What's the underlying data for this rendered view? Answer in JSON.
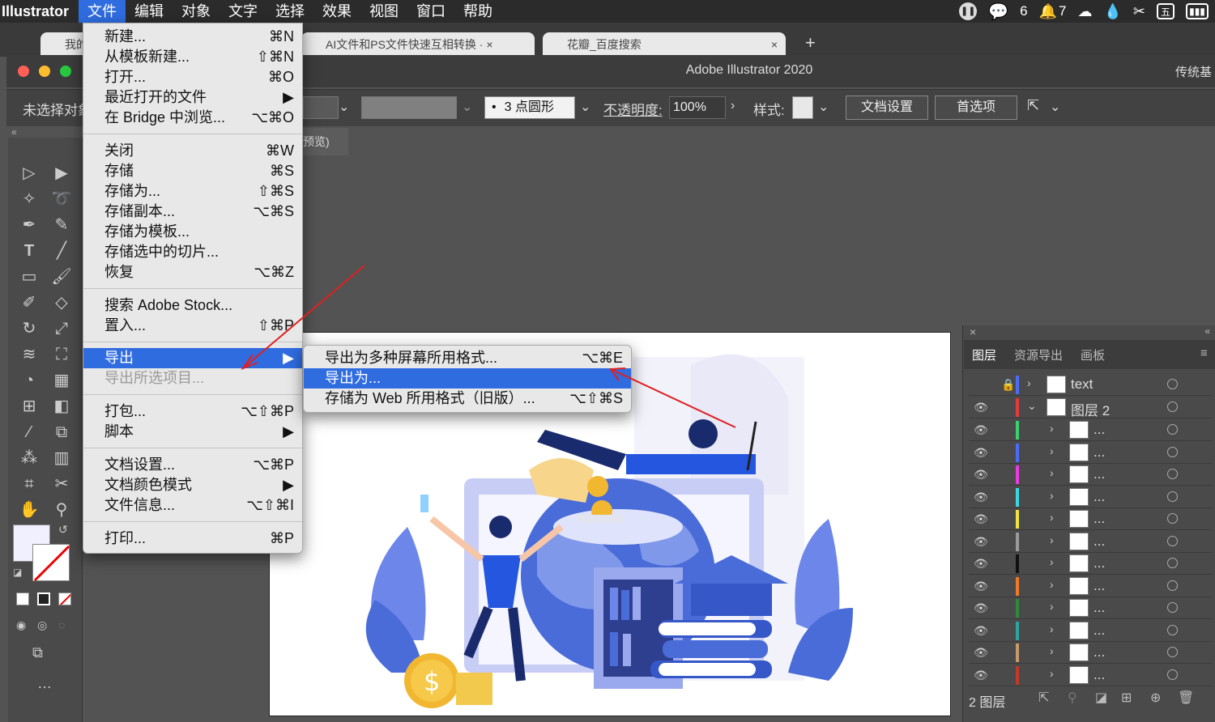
{
  "menubar": {
    "app_name": "Illustrator",
    "items": [
      "文件",
      "编辑",
      "对象",
      "文字",
      "选择",
      "效果",
      "视图",
      "窗口",
      "帮助"
    ],
    "right": {
      "wechat_count": "6",
      "bell_count": "7",
      "input_method": "五"
    }
  },
  "browser": {
    "tab1": "我的",
    "tab2": "AI文件和PS文件快速互相转换 · ×",
    "tab3": "花瓣_百度搜索",
    "tab3_close": "×",
    "new_tab": "+"
  },
  "window": {
    "title": "Adobe Illustrator 2020",
    "workspace": "传统基",
    "left_label": "未选择对象"
  },
  "controlbar": {
    "stroke_profile": "3 点圆形",
    "opacity_label": "不透明度:",
    "opacity_value": "100%",
    "style_label": "样式:",
    "doc_setup_button": "文档设置",
    "prefs_button": "首选项"
  },
  "doc_tab_fragment": "预览)",
  "file_menu": {
    "items": [
      {
        "label": "新建...",
        "shortcut": "⌘N"
      },
      {
        "label": "从模板新建...",
        "shortcut": "⇧⌘N"
      },
      {
        "label": "打开...",
        "shortcut": "⌘O"
      },
      {
        "label": "最近打开的文件",
        "shortcut": "▶"
      },
      {
        "label": "在 Bridge 中浏览...",
        "shortcut": "⌥⌘O"
      },
      {
        "label": "关闭",
        "shortcut": "⌘W"
      },
      {
        "label": "存储",
        "shortcut": "⌘S"
      },
      {
        "label": "存储为...",
        "shortcut": "⇧⌘S"
      },
      {
        "label": "存储副本...",
        "shortcut": "⌥⌘S"
      },
      {
        "label": "存储为模板...",
        "shortcut": ""
      },
      {
        "label": "存储选中的切片...",
        "shortcut": ""
      },
      {
        "label": "恢复",
        "shortcut": "⌥⌘Z"
      },
      {
        "label": "搜索 Adobe Stock...",
        "shortcut": ""
      },
      {
        "label": "置入...",
        "shortcut": "⇧⌘P"
      },
      {
        "label": "导出",
        "shortcut": "▶"
      },
      {
        "label": "导出所选项目...",
        "shortcut": ""
      },
      {
        "label": "打包...",
        "shortcut": "⌥⇧⌘P"
      },
      {
        "label": "脚本",
        "shortcut": "▶"
      },
      {
        "label": "文档设置...",
        "shortcut": "⌥⌘P"
      },
      {
        "label": "文档颜色模式",
        "shortcut": "▶"
      },
      {
        "label": "文件信息...",
        "shortcut": "⌥⇧⌘I"
      },
      {
        "label": "打印...",
        "shortcut": "⌘P"
      }
    ]
  },
  "export_submenu": {
    "items": [
      {
        "label": "导出为多种屏幕所用格式...",
        "shortcut": "⌥⌘E"
      },
      {
        "label": "导出为...",
        "shortcut": ""
      },
      {
        "label": "存储为 Web 所用格式（旧版）...",
        "shortcut": "⌥⇧⌘S"
      }
    ]
  },
  "layers_panel": {
    "tabs": [
      "图层",
      "资源导出",
      "画板"
    ],
    "layers": [
      {
        "name": "text",
        "color": "#4a6cf7",
        "expanded": false,
        "locked": true
      },
      {
        "name": "图层 2",
        "color": "#e53b3b",
        "expanded": true,
        "locked": false
      }
    ],
    "sublayer_colors": [
      "#3bd16f",
      "#4a6cf7",
      "#e93be0",
      "#3bd7e0",
      "#f2e33b",
      "#9a9a9a",
      "#111111",
      "#f07a28",
      "#2e8a3a",
      "#2aa3a3",
      "#c69a6a",
      "#c03a2a"
    ],
    "sublayer_name": "...",
    "footer_label": "2 图层"
  }
}
